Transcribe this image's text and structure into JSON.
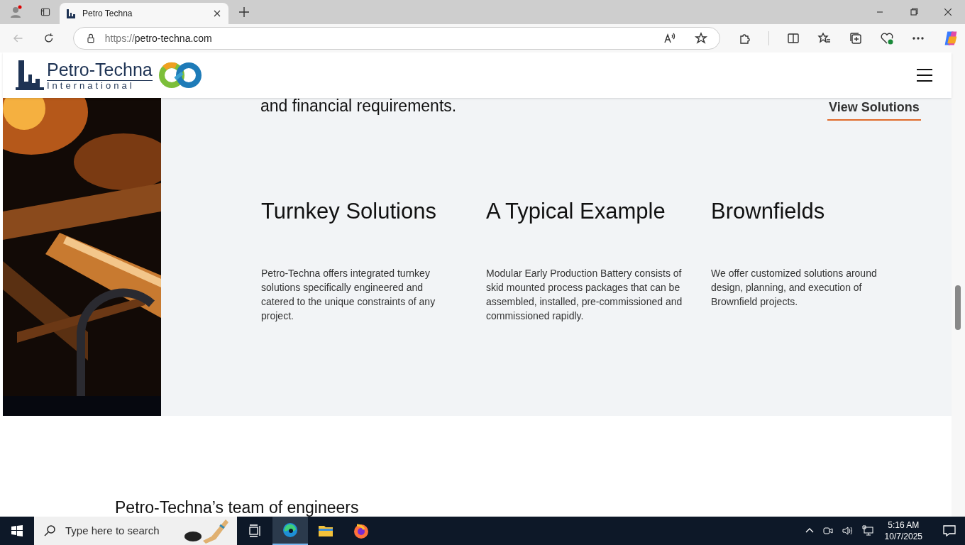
{
  "browser": {
    "tab_title": "Petro Techna",
    "url_scheme": "https://",
    "url_host": "petro-techna.com"
  },
  "site": {
    "logo_name": "Petro-Techna",
    "logo_sub": "International",
    "intro_tail": "and financial requirements.",
    "view_link": "View Solutions",
    "columns": [
      {
        "title": "Turnkey Solutions",
        "body": "Petro-Techna offers integrated turnkey solutions specifically engineered and catered to the unique constraints of any project."
      },
      {
        "title": "A Typical Example",
        "body": "Modular Early Production Battery consists of skid mounted process packages that can be assembled, installed, pre-commissioned and commissioned rapidly."
      },
      {
        "title": "Brownfields",
        "body": "We offer customized solutions around design, planning, and execution of Brownfield projects."
      }
    ],
    "team_heading": "Petro-Techna’s team of engineers"
  },
  "taskbar": {
    "search_placeholder": "Type here to search",
    "apps": [
      {
        "kind": "taskview",
        "selected": false
      },
      {
        "kind": "edge",
        "selected": true
      },
      {
        "kind": "folder",
        "selected": false
      },
      {
        "kind": "firefox",
        "selected": false
      }
    ],
    "time": "5:16 AM",
    "date": "10/7/2025"
  }
}
